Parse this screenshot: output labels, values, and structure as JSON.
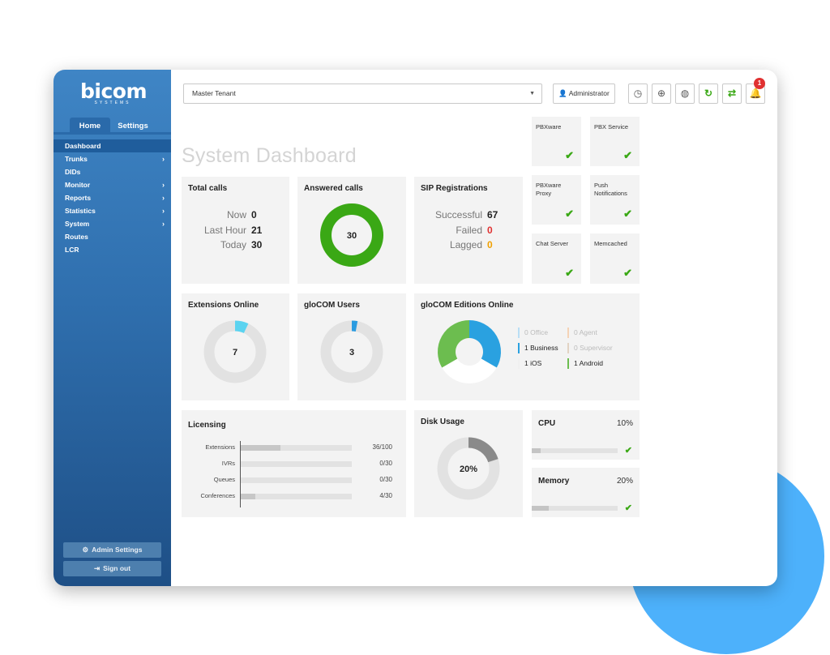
{
  "brand": {
    "name": "bicom",
    "sub": "SYSTEMS"
  },
  "sidebar": {
    "tabs": [
      {
        "label": "Home"
      },
      {
        "label": "Settings"
      }
    ],
    "items": [
      {
        "label": "Dashboard",
        "active": true,
        "arrow": false
      },
      {
        "label": "Trunks",
        "active": false,
        "arrow": true
      },
      {
        "label": "DIDs",
        "active": false,
        "arrow": false
      },
      {
        "label": "Monitor",
        "active": false,
        "arrow": true
      },
      {
        "label": "Reports",
        "active": false,
        "arrow": true
      },
      {
        "label": "Statistics",
        "active": false,
        "arrow": true
      },
      {
        "label": "System",
        "active": false,
        "arrow": true
      },
      {
        "label": "Routes",
        "active": false,
        "arrow": false
      },
      {
        "label": "LCR",
        "active": false,
        "arrow": false
      }
    ],
    "admin_settings": "Admin Settings",
    "sign_out": "Sign out"
  },
  "topbar": {
    "tenant": "Master Tenant",
    "user": "Administrator",
    "notification_count": "1",
    "icons": [
      "clock-icon",
      "globe-grid-icon",
      "globe-icon",
      "reload-icon",
      "sync-icon",
      "bell-icon"
    ]
  },
  "page_title": "System Dashboard",
  "total_calls": {
    "title": "Total calls",
    "rows": [
      {
        "label": "Now",
        "value": "0"
      },
      {
        "label": "Last Hour",
        "value": "21"
      },
      {
        "label": "Today",
        "value": "30"
      }
    ]
  },
  "answered_calls": {
    "title": "Answered calls",
    "value": "30",
    "fraction": 1.0,
    "color": "#3aa815"
  },
  "sip": {
    "title": "SIP Registrations",
    "rows": [
      {
        "label": "Successful",
        "value": "67",
        "color": "#222222"
      },
      {
        "label": "Failed",
        "value": "0",
        "color": "#e03131"
      },
      {
        "label": "Lagged",
        "value": "0",
        "color": "#f0a000"
      }
    ]
  },
  "services": [
    {
      "label": "PBXware",
      "status": "ok"
    },
    {
      "label": "PBX Service",
      "status": "ok"
    },
    {
      "label": "PBXware Proxy",
      "status": "ok"
    },
    {
      "label": "Push Notifications",
      "status": "ok"
    },
    {
      "label": "Chat Server",
      "status": "ok"
    },
    {
      "label": "Memcached",
      "status": "ok"
    }
  ],
  "extensions_online": {
    "title": "Extensions Online",
    "value": "7",
    "fraction": 0.07,
    "color": "#5bd3f0"
  },
  "glocom_users": {
    "title": "gloCOM Users",
    "value": "3",
    "fraction": 0.03,
    "color": "#2a9be0"
  },
  "glocom_editions": {
    "title": "gloCOM Editions Online",
    "legend": [
      {
        "count": "0",
        "label": "Office",
        "color": "#b9def5"
      },
      {
        "count": "0",
        "label": "Agent",
        "color": "#f5d3b6"
      },
      {
        "count": "1",
        "label": "Business",
        "color": "#2aa1e0"
      },
      {
        "count": "0",
        "label": "Supervisor",
        "color": "#e2d3c3"
      },
      {
        "count": "1",
        "label": "iOS",
        "color": "#f0f0f0"
      },
      {
        "count": "1",
        "label": "Android",
        "color": "#6cbd4f"
      }
    ],
    "slices": [
      {
        "label": "Business",
        "value": 1,
        "color": "#2aa1e0"
      },
      {
        "label": "iOS",
        "value": 1,
        "color": "#ffffff"
      },
      {
        "label": "Android",
        "value": 1,
        "color": "#6cbd4f"
      }
    ]
  },
  "licensing": {
    "title": "Licensing",
    "rows": [
      {
        "label": "Extensions",
        "value": "36/100",
        "fraction": 0.36
      },
      {
        "label": "IVRs",
        "value": "0/30",
        "fraction": 0
      },
      {
        "label": "Queues",
        "value": "0/30",
        "fraction": 0
      },
      {
        "label": "Conferences",
        "value": "4/30",
        "fraction": 0.1333
      }
    ]
  },
  "disk": {
    "title": "Disk Usage",
    "value": "20%",
    "fraction": 0.2,
    "color": "#8a8a8a"
  },
  "cpu": {
    "title": "CPU",
    "value": "10%",
    "fraction": 0.1
  },
  "memory": {
    "title": "Memory",
    "value": "20%",
    "fraction": 0.2
  }
}
